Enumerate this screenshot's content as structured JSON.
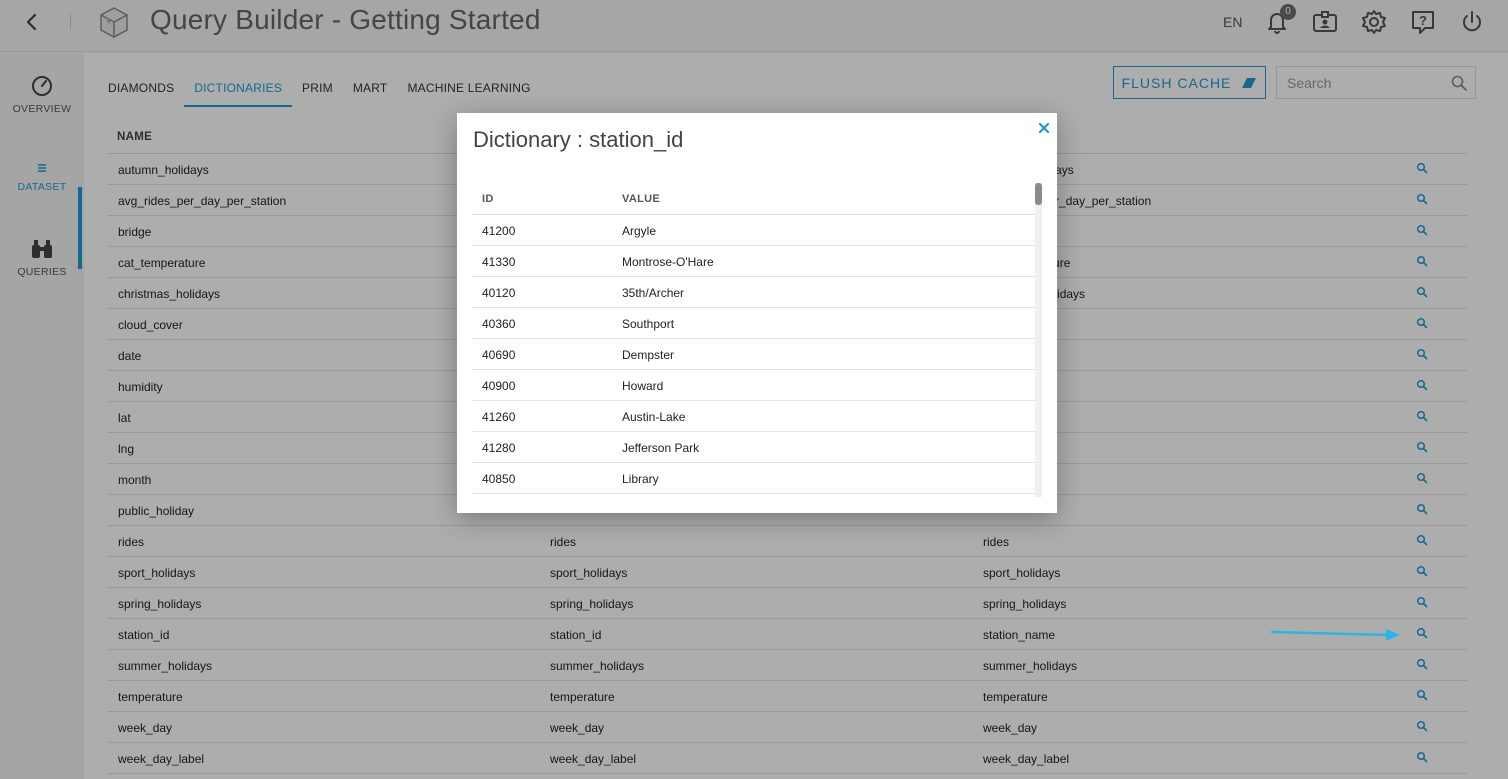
{
  "header": {
    "title": "Query Builder - Getting Started",
    "language": "EN",
    "notification_count": "0"
  },
  "sidebar": {
    "items": [
      {
        "label": "OVERVIEW",
        "icon": "speedometer-icon"
      },
      {
        "label": "DATASET",
        "icon": "list-icon",
        "active": true
      },
      {
        "label": "QUERIES",
        "icon": "binoculars-icon"
      }
    ]
  },
  "tabs": [
    "DIAMONDS",
    "DICTIONARIES",
    "PRIM",
    "MART",
    "MACHINE LEARNING"
  ],
  "active_tab": "DICTIONARIES",
  "flush_label": "FLUSH CACHE",
  "search": {
    "placeholder": "Search",
    "value": ""
  },
  "table": {
    "header": "NAME",
    "rows": [
      [
        "autumn_holidays",
        "",
        "autumn_holidays"
      ],
      [
        "avg_rides_per_day_per_station",
        "",
        "avg_rides_per_day_per_station"
      ],
      [
        "bridge",
        "",
        ""
      ],
      [
        "cat_temperature",
        "",
        "cat_temperature"
      ],
      [
        "christmas_holidays",
        "",
        "christmas_holidays"
      ],
      [
        "cloud_cover",
        "",
        ""
      ],
      [
        "date",
        "",
        ""
      ],
      [
        "humidity",
        "",
        ""
      ],
      [
        "lat",
        "",
        ""
      ],
      [
        "lng",
        "",
        ""
      ],
      [
        "month",
        "",
        ""
      ],
      [
        "public_holiday",
        "",
        ""
      ],
      [
        "rides",
        "rides",
        "rides"
      ],
      [
        "sport_holidays",
        "sport_holidays",
        "sport_holidays"
      ],
      [
        "spring_holidays",
        "spring_holidays",
        "spring_holidays"
      ],
      [
        "station_id",
        "station_id",
        "station_name"
      ],
      [
        "summer_holidays",
        "summer_holidays",
        "summer_holidays"
      ],
      [
        "temperature",
        "temperature",
        "temperature"
      ],
      [
        "week_day",
        "week_day",
        "week_day"
      ],
      [
        "week_day_label",
        "week_day_label",
        "week_day_label"
      ]
    ]
  },
  "modal": {
    "title": "Dictionary : station_id",
    "col_id": "ID",
    "col_value": "VALUE",
    "rows": [
      [
        "41200",
        "Argyle"
      ],
      [
        "41330",
        "Montrose-O'Hare"
      ],
      [
        "40120",
        "35th/Archer"
      ],
      [
        "40360",
        "Southport"
      ],
      [
        "40690",
        "Dempster"
      ],
      [
        "40900",
        "Howard"
      ],
      [
        "41260",
        "Austin-Lake"
      ],
      [
        "41280",
        "Jefferson Park"
      ],
      [
        "40850",
        "Library"
      ]
    ]
  },
  "colors": {
    "accent": "#1f9bd1",
    "arrow": "#29b6e8"
  }
}
